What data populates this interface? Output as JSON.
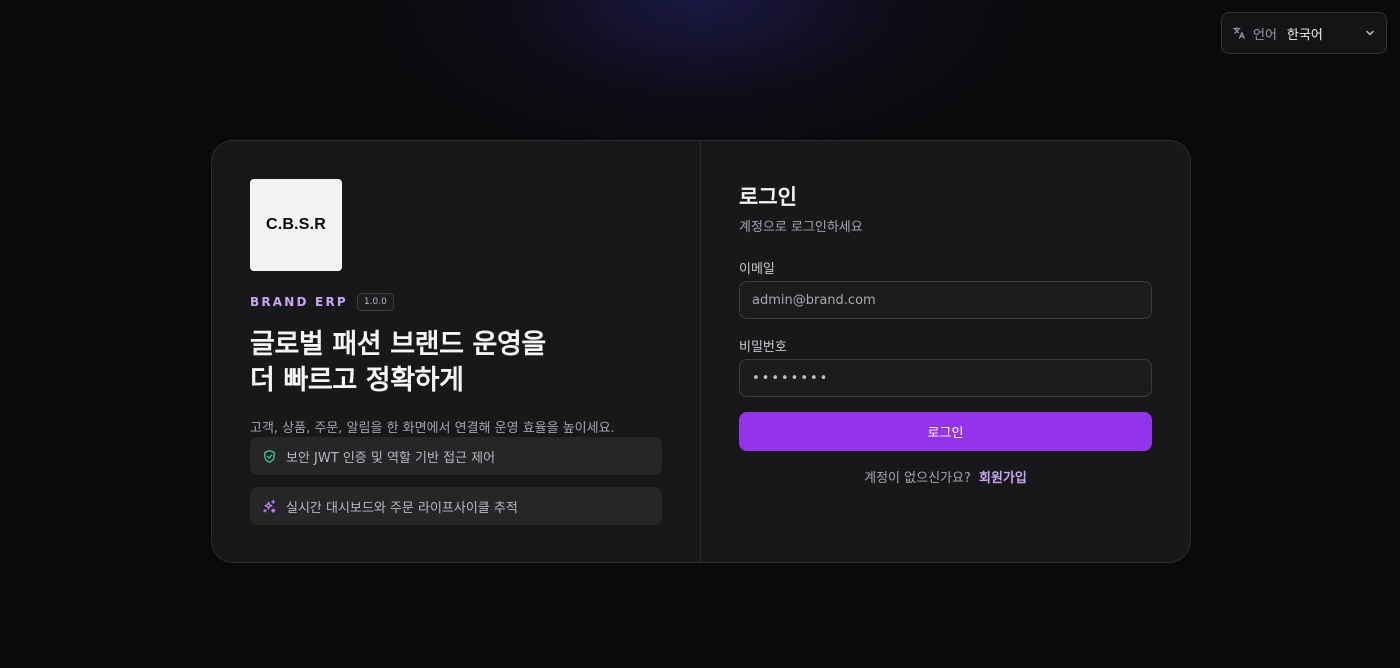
{
  "language": {
    "label": "언어",
    "value": "한국어"
  },
  "brand": {
    "logo_text": "C.B.S.R",
    "name": "BRAND ERP",
    "version": "1.0.0"
  },
  "hero": {
    "headline_line1": "글로벌 패션 브랜드 운영을",
    "headline_line2": "더 빠르고 정확하게",
    "description": "고객, 상품, 주문, 알림을 한 화면에서 연결해 운영 효율을 높이세요."
  },
  "features": [
    {
      "text": "보안 JWT 인증 및 역할 기반 접근 제어",
      "icon": "shield-check-icon"
    },
    {
      "text": "실시간 대시보드와 주문 라이프사이클 추적",
      "icon": "sparkles-icon"
    }
  ],
  "login": {
    "title": "로그인",
    "subtitle": "계정으로 로그인하세요",
    "email_label": "이메일",
    "email_placeholder": "admin@brand.com",
    "password_label": "비밀번호",
    "password_value": "••••••••",
    "submit_label": "로그인",
    "signup_prompt": "계정이 없으신가요?",
    "signup_link": "회원가입"
  },
  "colors": {
    "accent": "#9333ea",
    "brand_text": "#c9a6f2",
    "shield_icon": "#34d399",
    "sparkle_icon": "#c084fc"
  }
}
